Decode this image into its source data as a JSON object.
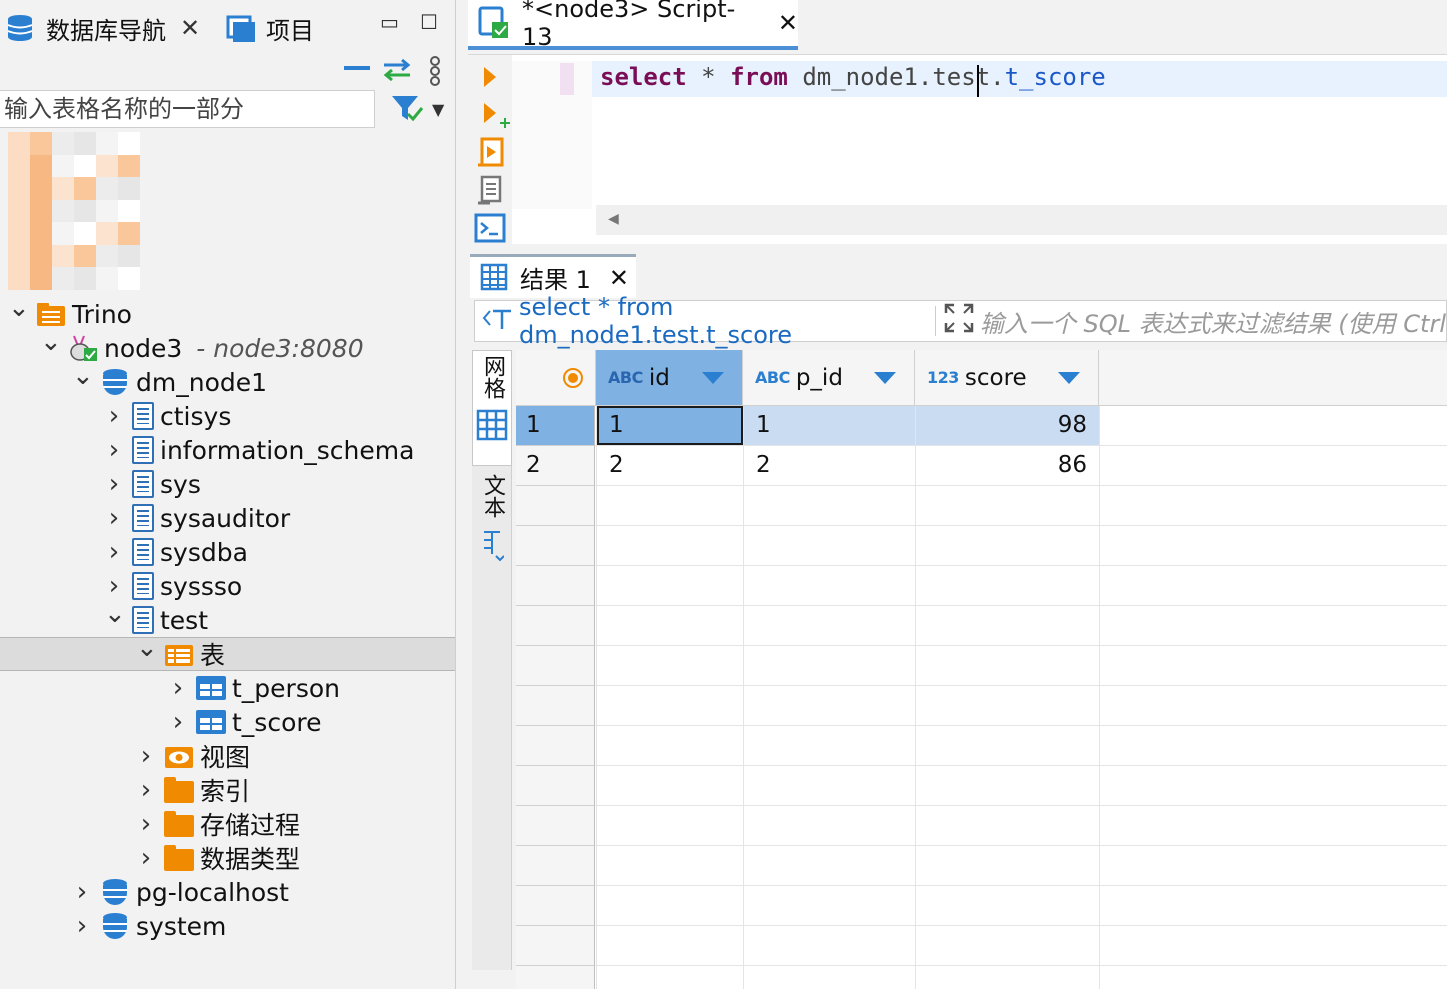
{
  "left_panel": {
    "tabs": [
      {
        "label": "数据库导航",
        "icon": "database-navigator-icon"
      },
      {
        "label": "项目",
        "icon": "projects-icon"
      }
    ],
    "filter_placeholder": "输入表格名称的一部分",
    "tree": [
      {
        "label": "Trino",
        "level": 0,
        "expanded": true,
        "icon": "folder-db-icon"
      },
      {
        "label": "node3",
        "sub": "- node3:8080",
        "level": 1,
        "expanded": true,
        "icon": "trino-connection-icon"
      },
      {
        "label": "dm_node1",
        "level": 2,
        "expanded": true,
        "icon": "database-icon"
      },
      {
        "label": "ctisys",
        "level": 3,
        "expanded": false,
        "icon": "schema-icon"
      },
      {
        "label": "information_schema",
        "level": 3,
        "expanded": false,
        "icon": "schema-icon"
      },
      {
        "label": "sys",
        "level": 3,
        "expanded": false,
        "icon": "schema-icon"
      },
      {
        "label": "sysauditor",
        "level": 3,
        "expanded": false,
        "icon": "schema-icon"
      },
      {
        "label": "sysdba",
        "level": 3,
        "expanded": false,
        "icon": "schema-icon"
      },
      {
        "label": "syssso",
        "level": 3,
        "expanded": false,
        "icon": "schema-icon"
      },
      {
        "label": "test",
        "level": 3,
        "expanded": true,
        "icon": "schema-icon"
      },
      {
        "label": "表",
        "level": 4,
        "expanded": true,
        "icon": "tables-folder-icon",
        "selected": true
      },
      {
        "label": "t_person",
        "level": 5,
        "expanded": false,
        "icon": "table-icon"
      },
      {
        "label": "t_score",
        "level": 5,
        "expanded": false,
        "icon": "table-icon"
      },
      {
        "label": "视图",
        "level": 4,
        "expanded": false,
        "icon": "views-folder-icon"
      },
      {
        "label": "索引",
        "level": 4,
        "expanded": false,
        "icon": "folder-icon"
      },
      {
        "label": "存储过程",
        "level": 4,
        "expanded": false,
        "icon": "folder-icon"
      },
      {
        "label": "数据类型",
        "level": 4,
        "expanded": false,
        "icon": "folder-icon"
      },
      {
        "label": "pg-localhost",
        "level": 2,
        "expanded": false,
        "icon": "database-icon"
      },
      {
        "label": "system",
        "level": 2,
        "expanded": false,
        "icon": "database-icon"
      }
    ]
  },
  "editor": {
    "tab_label": "*<node3> Script-13",
    "sql": {
      "kw1": "select",
      "star": " * ",
      "kw2": "from",
      "db": "dm_node1",
      "dot1": ".",
      "schema": "test",
      "dot2": ".",
      "table": "t_score"
    }
  },
  "results": {
    "tab_label": "结果 1",
    "filter_query": "select * from dm_node1.test.t_score",
    "filter_placeholder": "输入一个 SQL 表达式来过滤结果 (使用 Ctrl",
    "side_tabs": {
      "grid": "网格",
      "text": "文本"
    },
    "columns": [
      {
        "name": "id",
        "type": "ABC"
      },
      {
        "name": "p_id",
        "type": "ABC"
      },
      {
        "name": "score",
        "type": "123"
      }
    ],
    "rows": [
      {
        "num": "1",
        "id": "1",
        "p_id": "1",
        "score": "98"
      },
      {
        "num": "2",
        "id": "2",
        "p_id": "2",
        "score": "86"
      }
    ]
  },
  "colors": {
    "accent": "#2b7fd0",
    "keyword": "#7a0e56",
    "table_ident": "#1a57c8",
    "selection": "#7fb1e3",
    "folder": "#f08a00"
  }
}
